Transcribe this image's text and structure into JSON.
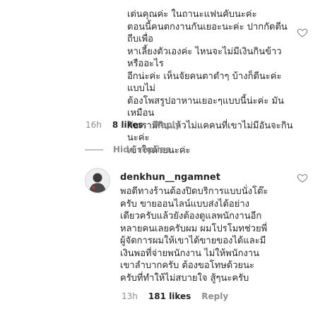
{
  "comment1": {
    "text": "เด่นคุณค่ะ ในถานะแฟนคับนะค่ะ\nตอนนี้คนตกงานกันเยอะนะค่ะ ปากกัดตีนถีบเพื่อ\nหาเลี้ยงตัวเองค่ะ ไหนจะไม่มีเงินกินข้าวหรืออะไร\nอีกน่ะค่ะ เห็นจัยคนตาดำๆ บ้างก็ดีนะค่ะแบบไม่\nต้องโพสรูปอาหานเยอะๆแบบนี้น่ะค่ะ มันเหมือน\nกับเรามีกินแล้วไม่แคคนที่เขาไม่มีอันจะกินนะค่ะ\nเข้าใจด้วยนะค่ะ",
    "time": "16h",
    "likes": "8 likes",
    "reply": "Reply"
  },
  "hide_replies": "Hide replies",
  "reply1": {
    "username": "denkhun__ngamnet",
    "text": "พอดีทางร้านต้องปิดบริการแบบนั่งโต๊ะ\nครับ ขายออนไลน์แบบส่งได้อย่าง\nเดียวครับแล้วยังต้องดูแลพนักงานอีก\nหลายคนเลยครับผม ผมโปรโมทช่วยพี่\nผู้จัดการผมให้เขาได้ขายของได้และมี\nเงินพอที่จ่ายพนักงาน ไม่ให้พนักงาน\nเขาลำบากครับ ต้องขอโทษด้วยนะ\nครับที่ทำให้ไม่สบายใจ สู้ๆนะครับ",
    "time": "13h",
    "likes": "181 likes",
    "reply": "Reply"
  }
}
